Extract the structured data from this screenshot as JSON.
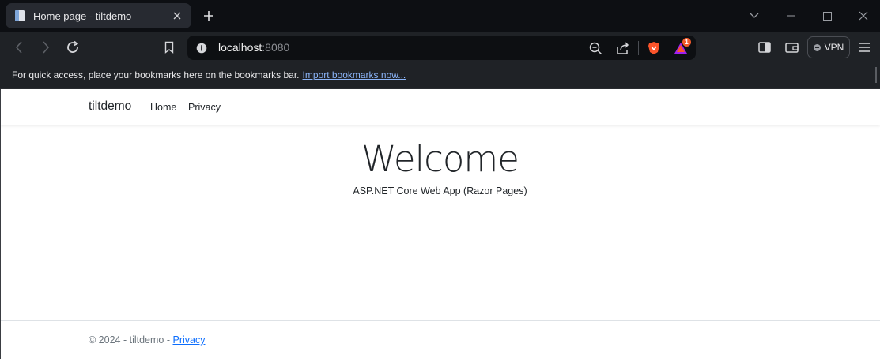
{
  "browser": {
    "tab": {
      "title": "Home page - tiltdemo"
    },
    "address": {
      "host": "localhost",
      "port": ":8080"
    },
    "shields_badge": "1",
    "vpn_label": "VPN",
    "bookmarks_bar": {
      "message": "For quick access, place your bookmarks here on the bookmarks bar.",
      "import_link": "Import bookmarks now..."
    }
  },
  "page": {
    "navbar": {
      "brand": "tiltdemo",
      "links": [
        "Home",
        "Privacy"
      ]
    },
    "heading": "Welcome",
    "subtitle": "ASP.NET Core Web App (Razor Pages)",
    "footer": {
      "text": "© 2024 - tiltdemo - ",
      "link": "Privacy"
    }
  },
  "colors": {
    "chrome_bg": "#0d0f13",
    "toolbar_bg": "#1f2226",
    "link_blue": "#0d6efd",
    "bookmark_link": "#8ab4f8"
  }
}
